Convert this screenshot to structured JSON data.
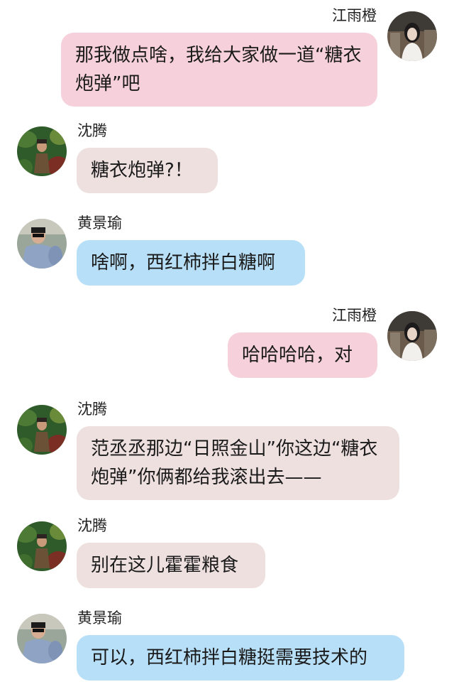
{
  "messages": [
    {
      "sender": "江雨橙",
      "text": "那我做点啥，我给大家做一道“糖衣炮弹”吧"
    },
    {
      "sender": "沈腾",
      "text": "糖衣炮弹?！"
    },
    {
      "sender": "黄景瑜",
      "text": "啥啊，西红柿拌白糖啊"
    },
    {
      "sender": "江雨橙",
      "text": "哈哈哈哈，对"
    },
    {
      "sender": "沈腾",
      "text": "范丞丞那边“日照金山”你这边“糖衣炮弹”你俩都给我滚出去——"
    },
    {
      "sender": "沈腾",
      "text": "别在这儿霍霍粮食"
    },
    {
      "sender": "黄景瑜",
      "text": "可以，西红柿拌白糖挺需要技术的"
    }
  ],
  "colors": {
    "bubble_pink": "#f6d1dc",
    "bubble_gray": "#efe0e0",
    "bubble_blue": "#b8dff8"
  },
  "icons": {
    "jiang_avatar": "jiang-yucheng-avatar",
    "shen_avatar": "shen-teng-avatar",
    "huang_avatar": "huang-jingyu-avatar"
  }
}
